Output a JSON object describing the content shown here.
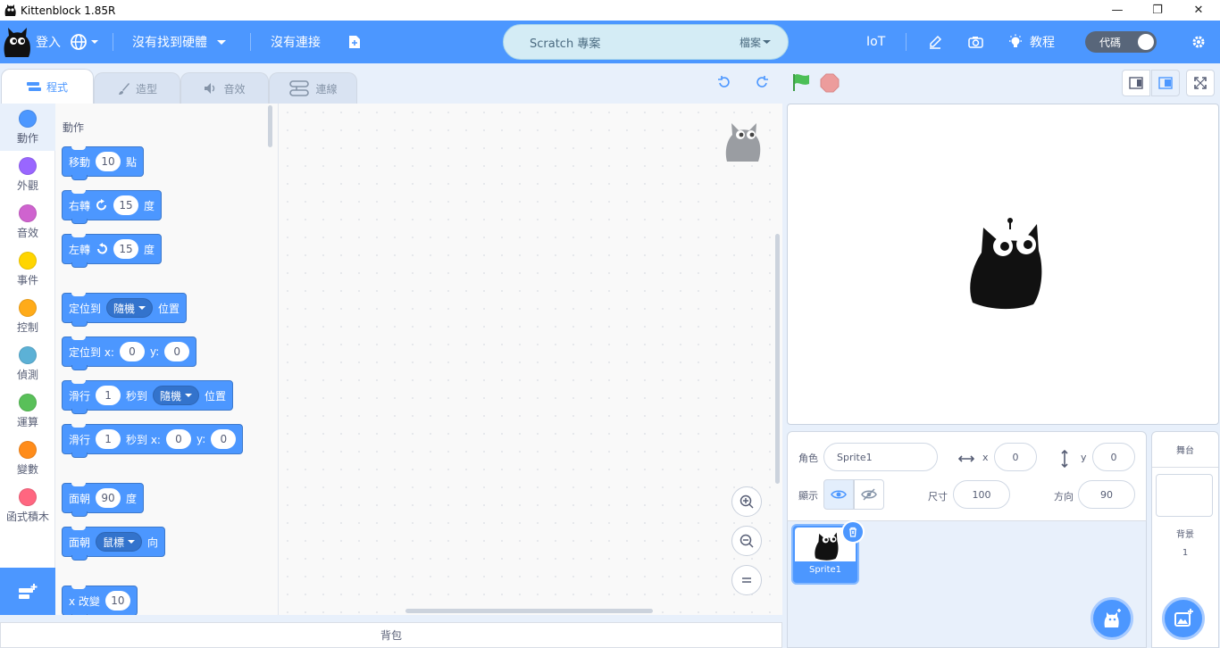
{
  "window": {
    "title": "Kittenblock 1.85R",
    "minimize": "—",
    "restore": "❐",
    "close": "✕"
  },
  "menubar": {
    "login": "登入",
    "hardware": "沒有找到硬體",
    "connection": "沒有連接",
    "project_title": "Scratch 專案",
    "file_menu": "檔案",
    "iot": "IoT",
    "tutorial": "教程",
    "code_toggle": "代碼"
  },
  "tabs": [
    {
      "label": "程式"
    },
    {
      "label": "造型"
    },
    {
      "label": "音效"
    },
    {
      "label": "連線"
    }
  ],
  "categories": [
    {
      "label": "動作",
      "color": "#4c97ff"
    },
    {
      "label": "外觀",
      "color": "#9966ff"
    },
    {
      "label": "音效",
      "color": "#cf63cf"
    },
    {
      "label": "事件",
      "color": "#ffd500"
    },
    {
      "label": "控制",
      "color": "#ffab19"
    },
    {
      "label": "偵測",
      "color": "#5cb1d6"
    },
    {
      "label": "運算",
      "color": "#59c059"
    },
    {
      "label": "變數",
      "color": "#ff8c1a"
    },
    {
      "label": "函式積木",
      "color": "#ff6680"
    }
  ],
  "palette": {
    "section_title": "動作",
    "blocks": {
      "move": {
        "label": "移動",
        "value": "10",
        "suffix": "點"
      },
      "turn_right": {
        "label": "右轉",
        "value": "15",
        "suffix": "度"
      },
      "turn_left": {
        "label": "左轉",
        "value": "15",
        "suffix": "度"
      },
      "goto": {
        "label": "定位到",
        "option": "隨機",
        "suffix": "位置"
      },
      "goto_xy": {
        "label": "定位到 x:",
        "x": "0",
        "ylabel": "y:",
        "y": "0"
      },
      "glide": {
        "label": "滑行",
        "secs": "1",
        "mid": "秒到",
        "option": "隨機",
        "suffix": "位置"
      },
      "glide_xy": {
        "label": "滑行",
        "secs": "1",
        "mid": "秒到 x:",
        "x": "0",
        "ylabel": "y:",
        "y": "0"
      },
      "point_dir": {
        "label": "面朝",
        "value": "90",
        "suffix": "度"
      },
      "point_towards": {
        "label": "面朝",
        "option": "鼠標",
        "suffix": "向"
      },
      "change_x": {
        "label": "x 改變",
        "value": "10"
      }
    }
  },
  "backpack": "背包",
  "sprite_info": {
    "sprite_label": "角色",
    "sprite_name": "Sprite1",
    "x_label": "x",
    "x_value": "0",
    "y_label": "y",
    "y_value": "0",
    "show_label": "顯示",
    "size_label": "尺寸",
    "size_value": "100",
    "direction_label": "方向",
    "direction_value": "90"
  },
  "sprites": [
    {
      "name": "Sprite1"
    }
  ],
  "stage_pane": {
    "title": "舞台",
    "backdrops_label": "背景",
    "backdrops_count": "1"
  },
  "colors": {
    "accent": "#4c97ff",
    "flag": "#4cbf56",
    "stop": "#ec9c9c"
  }
}
